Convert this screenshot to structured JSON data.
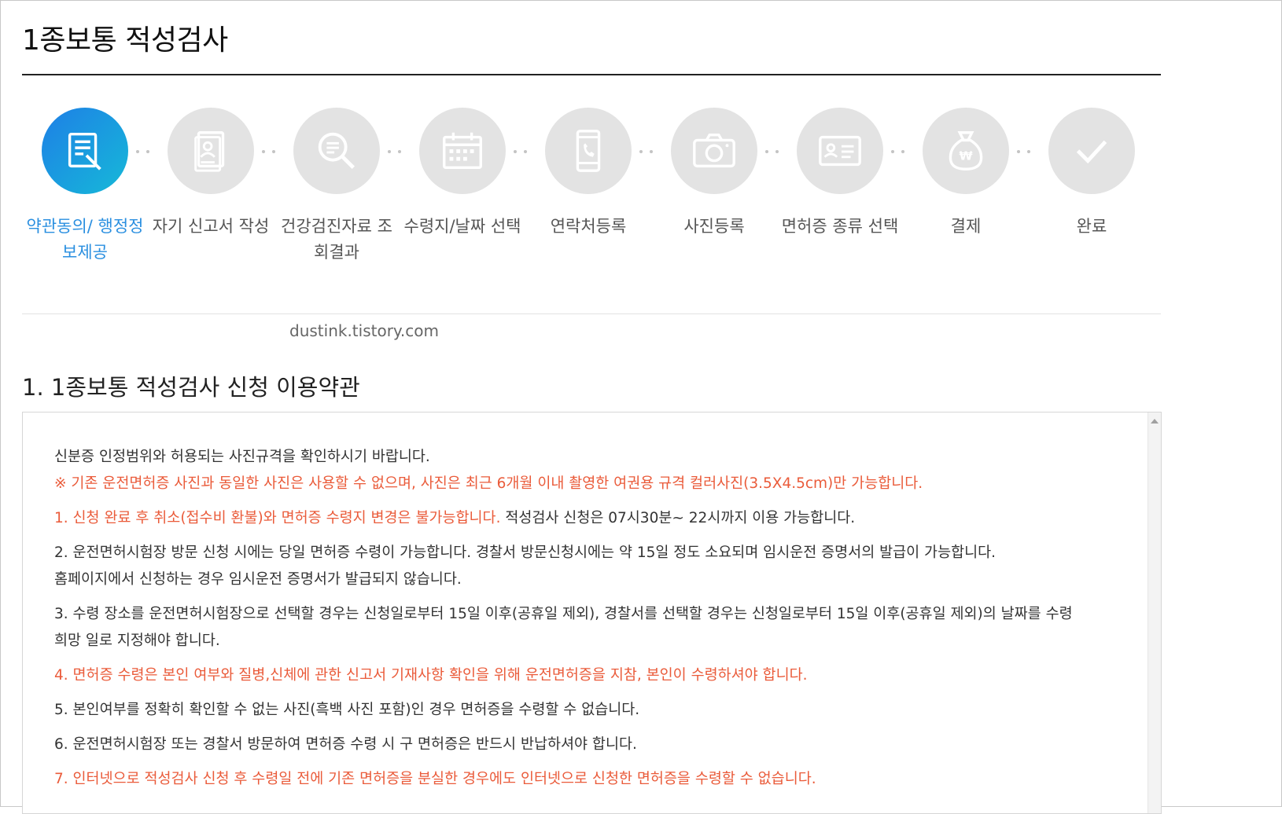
{
  "page": {
    "title": "1종보통 적성검사"
  },
  "steps": [
    {
      "label": "약관동의/ 행정정보제공",
      "icon": "document-pen-icon",
      "active": true
    },
    {
      "label": "자기 신고서 작성",
      "icon": "user-document-icon",
      "active": false
    },
    {
      "label": "건강검진자료 조회결과",
      "icon": "magnifier-icon",
      "active": false
    },
    {
      "label": "수령지/날짜 선택",
      "icon": "calendar-icon",
      "active": false
    },
    {
      "label": "연락처등록",
      "icon": "phone-icon",
      "active": false
    },
    {
      "label": "사진등록",
      "icon": "camera-icon",
      "active": false
    },
    {
      "label": "면허증 종류 선택",
      "icon": "id-card-icon",
      "active": false
    },
    {
      "label": "결제",
      "icon": "money-bag-icon",
      "active": false
    },
    {
      "label": "완료",
      "icon": "check-icon",
      "active": false
    }
  ],
  "watermark": "dustink.tistory.com",
  "section": {
    "title": "1. 1종보통 적성검사 신청 이용약관"
  },
  "terms": {
    "intro": "신분증 인정범위와 허용되는 사진규격을 확인하시기 바랍니다.",
    "notice": "※ 기존 운전면허증 사진과 동일한 사진은 사용할 수 없으며, 사진은 최근 6개월 이내 촬영한 여권용 규격 컬러사진(3.5X4.5cm)만 가능합니다.",
    "item1_red": "1. 신청 완료 후 취소(접수비 환불)와 면허증 수령지 변경은 불가능합니다.",
    "item1_rest": " 적성검사 신청은 07시30분~ 22시까지 이용 가능합니다.",
    "item2_line1": "2. 운전면허시험장 방문 신청 시에는 당일 면허증 수령이 가능합니다. 경찰서 방문신청시에는 약 15일 정도 소요되며 임시운전 증명서의 발급이 가능합니다.",
    "item2_line2": "홈페이지에서 신청하는 경우 임시운전 증명서가 발급되지 않습니다.",
    "item3_line1": "3. 수령 장소를 운전면허시험장으로 선택할 경우는 신청일로부터 15일 이후(공휴일 제외), 경찰서를 선택할 경우는 신청일로부터 15일 이후(공휴일 제외)의 날짜를 수령",
    "item3_line2": "희망 일로 지정해야 합니다.",
    "item4": "4. 면허증 수령은 본인 여부와 질병,신체에 관한 신고서 기재사항 확인을 위해 운전면허증을 지참, 본인이 수령하셔야 합니다.",
    "item5": "5. 본인여부를 정확히 확인할 수 없는 사진(흑백 사진 포함)인 경우 면허증을 수령할 수 없습니다.",
    "item6": "6. 운전면허시험장 또는 경찰서 방문하여 면허증 수령 시 구 면허증은 반드시 반납하셔야 합니다.",
    "item7": "7. 인터넷으로 적성검사 신청 후 수령일 전에 기존 면허증을 분실한 경우에도 인터넷으로 신청한 면허증을 수령할 수 없습니다."
  },
  "colors": {
    "accent": "#2a8fe0",
    "warning": "#ea5b3a",
    "inactive_step": "#e3e3e3"
  }
}
